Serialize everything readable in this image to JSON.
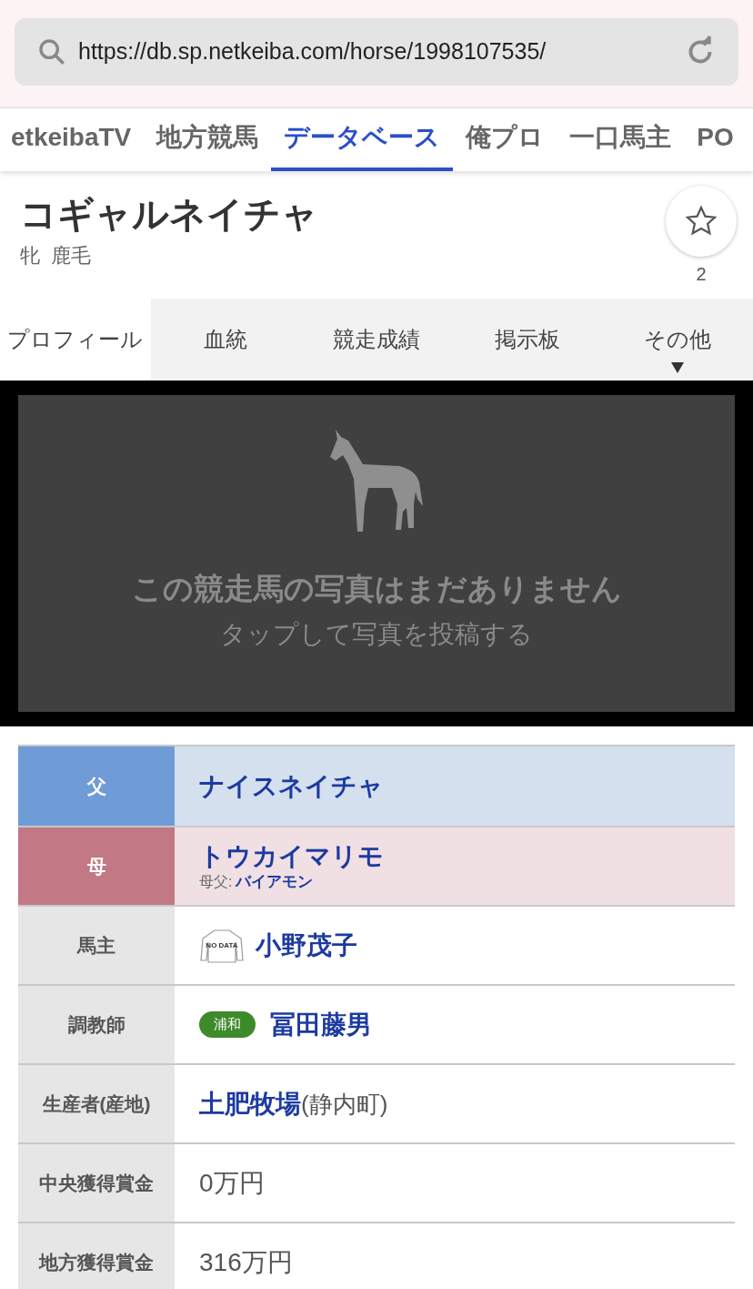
{
  "address_bar": {
    "url": "https://db.sp.netkeiba.com/horse/1998107535/"
  },
  "nav_tabs": [
    {
      "label": "etkeibaTV",
      "selected": false
    },
    {
      "label": "地方競馬",
      "selected": false
    },
    {
      "label": "データベース",
      "selected": true
    },
    {
      "label": "俺プロ",
      "selected": false
    },
    {
      "label": "一口馬主",
      "selected": false
    },
    {
      "label": "PO",
      "selected": false
    }
  ],
  "horse": {
    "name": "コギャルネイチャ",
    "sex": "牝",
    "coat": "鹿毛",
    "favorite_count": "2"
  },
  "tabs": [
    {
      "label": "プロフィール",
      "selected": true,
      "dropdown": false
    },
    {
      "label": "血統",
      "selected": false,
      "dropdown": false
    },
    {
      "label": "競走成績",
      "selected": false,
      "dropdown": false
    },
    {
      "label": "掲示板",
      "selected": false,
      "dropdown": false
    },
    {
      "label": "その他",
      "selected": false,
      "dropdown": true
    }
  ],
  "photo": {
    "title": "この競走馬の写真はまだありません",
    "subtitle": "タップして写真を投稿する"
  },
  "profile": [
    {
      "kind": "sire",
      "label": "父",
      "value": "ナイスネイチャ"
    },
    {
      "kind": "dam",
      "label": "母",
      "value": "トウカイマリモ",
      "sub_label": "母父:",
      "sub_value": "バイアモン"
    },
    {
      "kind": "owner",
      "label": "馬主",
      "silks": "NO DATA",
      "value": "小野茂子"
    },
    {
      "kind": "trainer",
      "label": "調教師",
      "badge": "浦和",
      "value": "冨田藤男"
    },
    {
      "kind": "breeder",
      "label": "生産者(産地)",
      "value": "土肥牧場",
      "extra": "(静内町)"
    },
    {
      "kind": "plain",
      "label": "中央獲得賞金",
      "value": "0万円"
    },
    {
      "kind": "plain",
      "label": "地方獲得賞金",
      "value": "316万円"
    }
  ]
}
